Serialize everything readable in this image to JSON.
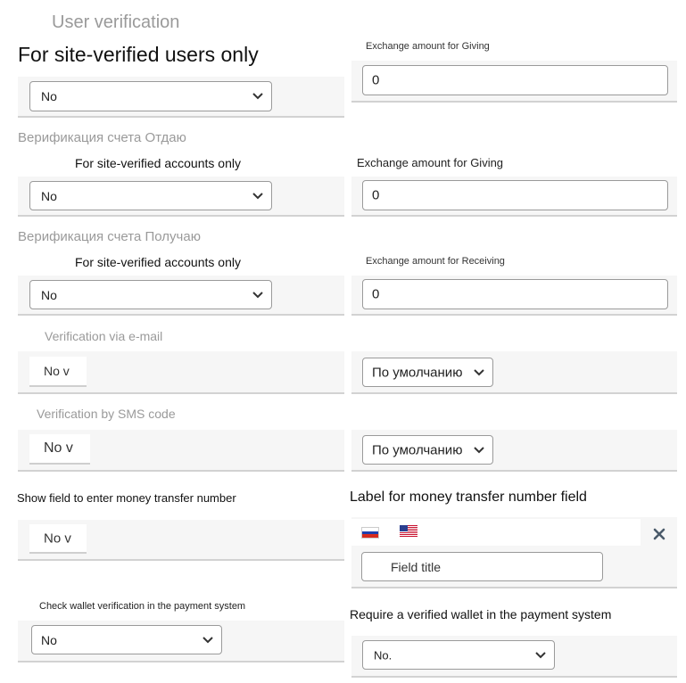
{
  "header": {
    "title": "User verification"
  },
  "rows": {
    "site_verified_users": {
      "label": "For site-verified users only",
      "select_value": "No",
      "amount_label": "Exchange amount for Giving",
      "amount_value": "0"
    },
    "verify_giving": {
      "section_title": "Верификация счета Отдаю",
      "label": "For site-verified accounts only",
      "select_value": "No",
      "amount_label": "Exchange amount for Giving",
      "amount_value": "0"
    },
    "verify_receiving": {
      "section_title": "Верификация счета Получаю",
      "label": "For site-verified accounts only",
      "select_value": "No",
      "amount_label": "Exchange amount for Receiving",
      "amount_value": "0"
    },
    "email_verification": {
      "label": "Verification via e-mail",
      "toggle_value": "No v",
      "default_value": "По умолчанию"
    },
    "sms_verification": {
      "label": "Verification by SMS code",
      "toggle_value": "No v",
      "default_value": "По умолчанию"
    },
    "transfer_number": {
      "label": "Show field to enter money transfer number",
      "toggle_value": "No v",
      "field_label": "Label for money transfer number field",
      "field_placeholder": "Field title"
    },
    "wallet_verification": {
      "label": "Check wallet verification in the payment system",
      "select_value": "No",
      "require_label": "Require a verified wallet in the payment system",
      "require_value": "No."
    }
  },
  "icons": {
    "chevron": "chevron-down-icon",
    "close": "close-icon",
    "flag_ru": "russia-flag-icon",
    "flag_us": "usa-flag-icon"
  },
  "colors": {
    "panel_bg": "#f6f6f6",
    "muted_text": "#9a9a9a",
    "close_icon": "#4a5a6a"
  }
}
